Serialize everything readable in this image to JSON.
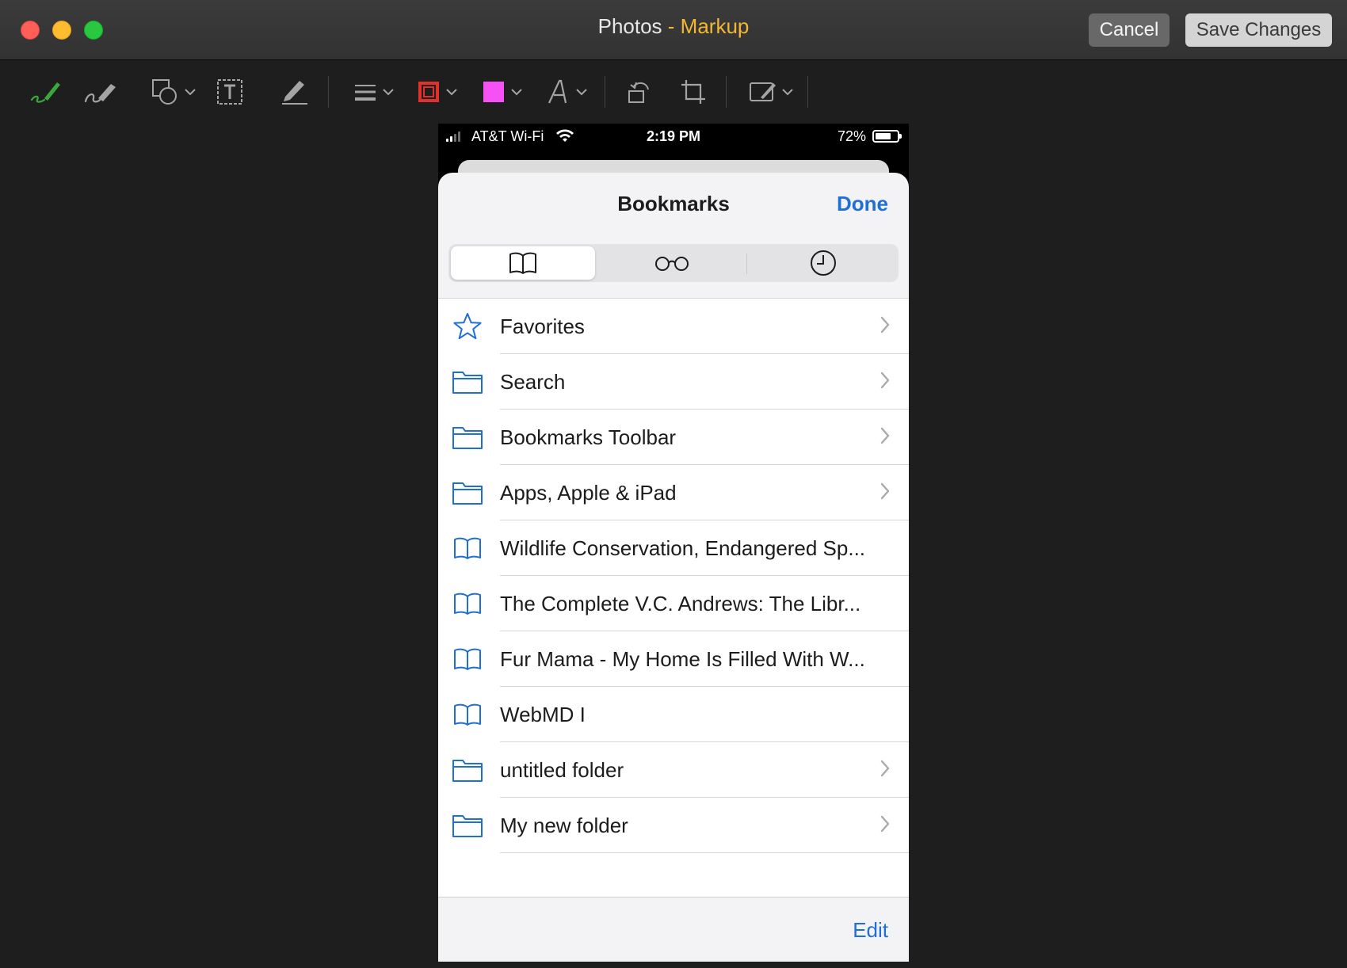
{
  "window": {
    "title_app": "Photos",
    "title_sep": " - ",
    "title_sub": "Markup",
    "cancel_label": "Cancel",
    "save_label": "Save Changes"
  },
  "toolbar": {
    "tools": [
      "sketch-tool",
      "draw-tool",
      "shapes-tool",
      "text-tool",
      "sign-tool",
      "shape-style-tool",
      "border-color-tool",
      "fill-color-tool",
      "text-style-tool",
      "rotate-tool",
      "crop-tool",
      "annotate-tool"
    ],
    "sketch_color": "#3aa83a",
    "border_color": "#e0312b",
    "fill_color": "#f551f5"
  },
  "phone": {
    "status": {
      "carrier": "AT&T Wi-Fi",
      "time": "2:19 PM",
      "battery": "72%",
      "battery_level": 0.72
    },
    "sheet": {
      "title": "Bookmarks",
      "done": "Done",
      "segments": [
        "bookmarks-icon",
        "reading-list-icon",
        "history-icon"
      ],
      "selected_segment": 0,
      "edit": "Edit"
    },
    "items": [
      {
        "label": "Favorites",
        "icon": "star-icon",
        "chevron": true
      },
      {
        "label": "Search",
        "icon": "folder-icon",
        "chevron": true
      },
      {
        "label": "Bookmarks Toolbar",
        "icon": "folder-icon",
        "chevron": true
      },
      {
        "label": "Apps, Apple & iPad",
        "icon": "folder-icon",
        "chevron": true
      },
      {
        "label": "Wildlife Conservation, Endangered Sp...",
        "icon": "book-icon",
        "chevron": false
      },
      {
        "label": "The Complete V.C. Andrews: The Libr...",
        "icon": "book-icon",
        "chevron": false
      },
      {
        "label": "Fur Mama - My Home Is Filled With W...",
        "icon": "book-icon",
        "chevron": false
      },
      {
        "label": "WebMD I",
        "icon": "book-icon",
        "chevron": false
      },
      {
        "label": "untitled folder",
        "icon": "folder-icon",
        "chevron": true
      },
      {
        "label": "My new folder",
        "icon": "folder-icon",
        "chevron": true
      }
    ],
    "accent": "#1f6fd6"
  }
}
